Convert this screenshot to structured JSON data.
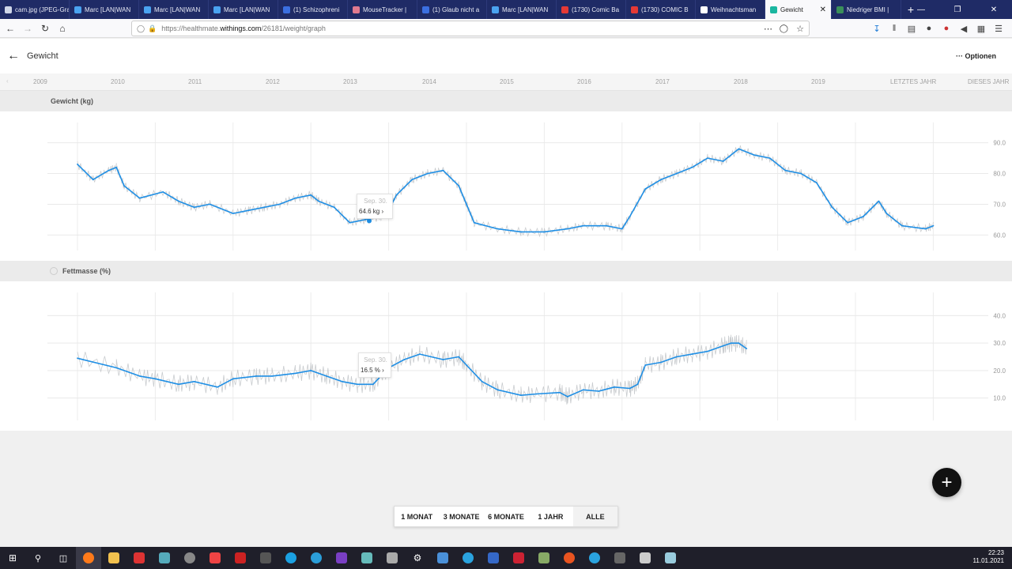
{
  "browser": {
    "tabs": [
      {
        "label": "cam.jpg (JPEG-Grafik",
        "icon": "image-icon",
        "color": "#cfd6e8"
      },
      {
        "label": "Marc [LAN|WAN",
        "icon": "twitter-icon",
        "color": "#4aa3f0"
      },
      {
        "label": "Marc [LAN|WAN",
        "icon": "twitter-icon",
        "color": "#4aa3f0"
      },
      {
        "label": "Marc [LAN|WAN",
        "icon": "twitter-icon",
        "color": "#4aa3f0"
      },
      {
        "label": "(1) Schizophreni",
        "icon": "facebook-icon",
        "color": "#3b6fe0"
      },
      {
        "label": "MouseTracker |",
        "icon": "mousetracker-icon",
        "color": "#e07a8f"
      },
      {
        "label": "(1) Glaub nicht a",
        "icon": "facebook-icon",
        "color": "#3b6fe0"
      },
      {
        "label": "Marc [LAN|WAN",
        "icon": "twitter-icon",
        "color": "#4aa3f0"
      },
      {
        "label": "(1730) Comic Ba",
        "icon": "youtube-icon",
        "color": "#e53935"
      },
      {
        "label": "(1730) COMIC B",
        "icon": "youtube-icon",
        "color": "#e53935"
      },
      {
        "label": "Weihnachtsman",
        "icon": "google-icon",
        "color": "#ffffff"
      },
      {
        "label": "Gewicht",
        "icon": "withings-icon",
        "color": "#1ab6a0",
        "active": true
      },
      {
        "label": "Niedriger BMI |",
        "icon": "page-icon",
        "color": "#3a8f5a"
      }
    ],
    "url_prefix": "https://healthmate.",
    "url_domain": "withings.com",
    "url_path": "/26181/weight/graph"
  },
  "header": {
    "title": "Gewicht",
    "options_label": "Optionen"
  },
  "timeline": {
    "years": [
      "2009",
      "2010",
      "2011",
      "2012",
      "2013",
      "2014",
      "2015",
      "2016",
      "2017",
      "2018",
      "2019"
    ],
    "last_year": "LETZTES JAHR",
    "this_year": "DIESES JAHR"
  },
  "weight_chart": {
    "title": "Gewicht (kg)",
    "tooltip_date": "Sep. 30.",
    "tooltip_value": "64.6 kg"
  },
  "fat_chart": {
    "title": "Fettmasse (%)",
    "tooltip_date": "Sep. 30.",
    "tooltip_value": "16.5 %"
  },
  "range_buttons": [
    "1 MONAT",
    "3 MONATE",
    "6 MONATE",
    "1 JAHR",
    "ALLE"
  ],
  "fab_label": "+",
  "clock": {
    "time": "22:23",
    "date": "11.01.2021"
  },
  "chart_data": [
    {
      "type": "line",
      "title": "Gewicht (kg)",
      "ylim": [
        57,
        93
      ],
      "yticks": [
        60.0,
        70.0,
        80.0,
        90.0
      ],
      "grid": true,
      "x_unit": "year",
      "series": [
        {
          "values": [
            [
              2009.5,
              83
            ],
            [
              2009.7,
              78
            ],
            [
              2009.9,
              81
            ],
            [
              2010.0,
              82
            ],
            [
              2010.1,
              76
            ],
            [
              2010.3,
              72
            ],
            [
              2010.6,
              74
            ],
            [
              2010.8,
              71
            ],
            [
              2011.0,
              69
            ],
            [
              2011.2,
              70
            ],
            [
              2011.5,
              67
            ],
            [
              2011.7,
              68
            ],
            [
              2011.9,
              69
            ],
            [
              2012.1,
              70
            ],
            [
              2012.3,
              72
            ],
            [
              2012.5,
              73
            ],
            [
              2012.6,
              71
            ],
            [
              2012.8,
              69
            ],
            [
              2013.0,
              64
            ],
            [
              2013.2,
              65
            ],
            [
              2013.4,
              66
            ],
            [
              2013.5,
              68
            ],
            [
              2013.6,
              73
            ],
            [
              2013.8,
              78
            ],
            [
              2014.0,
              80
            ],
            [
              2014.2,
              81
            ],
            [
              2014.4,
              76
            ],
            [
              2014.5,
              70
            ],
            [
              2014.6,
              64
            ],
            [
              2014.9,
              62
            ],
            [
              2015.2,
              61
            ],
            [
              2015.5,
              61
            ],
            [
              2015.8,
              62
            ],
            [
              2016.0,
              63
            ],
            [
              2016.3,
              63
            ],
            [
              2016.5,
              62
            ],
            [
              2016.6,
              66
            ],
            [
              2016.8,
              75
            ],
            [
              2017.0,
              78
            ],
            [
              2017.2,
              80
            ],
            [
              2017.4,
              82
            ],
            [
              2017.6,
              85
            ],
            [
              2017.8,
              84
            ],
            [
              2018.0,
              88
            ],
            [
              2018.2,
              86
            ],
            [
              2018.4,
              85
            ],
            [
              2018.6,
              81
            ],
            [
              2018.8,
              80
            ],
            [
              2019.0,
              77
            ],
            [
              2019.2,
              69
            ],
            [
              2019.4,
              64
            ],
            [
              2019.6,
              66
            ],
            [
              2019.8,
              71
            ],
            [
              2019.9,
              67
            ],
            [
              2020.1,
              63
            ],
            [
              2020.4,
              62
            ],
            [
              2020.5,
              63
            ]
          ]
        }
      ]
    },
    {
      "type": "line",
      "title": "Fettmasse (%)",
      "ylim": [
        3,
        43
      ],
      "yticks": [
        10.0,
        20.0,
        30.0,
        40.0
      ],
      "grid": true,
      "x_unit": "year",
      "series": [
        {
          "values": [
            [
              2009.5,
              24.5
            ],
            [
              2010.0,
              21
            ],
            [
              2010.3,
              18
            ],
            [
              2010.5,
              17
            ],
            [
              2010.8,
              15
            ],
            [
              2011.0,
              16
            ],
            [
              2011.3,
              14
            ],
            [
              2011.5,
              17
            ],
            [
              2011.8,
              18
            ],
            [
              2012.0,
              18
            ],
            [
              2012.3,
              19
            ],
            [
              2012.5,
              20
            ],
            [
              2012.7,
              18
            ],
            [
              2012.9,
              16
            ],
            [
              2013.1,
              15
            ],
            [
              2013.3,
              15
            ],
            [
              2013.5,
              21
            ],
            [
              2013.7,
              24
            ],
            [
              2013.9,
              26
            ],
            [
              2014.2,
              24
            ],
            [
              2014.4,
              25
            ],
            [
              2014.5,
              22
            ],
            [
              2014.7,
              16
            ],
            [
              2014.9,
              13
            ],
            [
              2015.2,
              11
            ],
            [
              2015.4,
              11.5
            ],
            [
              2015.7,
              12
            ],
            [
              2015.8,
              10.5
            ],
            [
              2016.0,
              13
            ],
            [
              2016.2,
              12.5
            ],
            [
              2016.4,
              14
            ],
            [
              2016.6,
              13.5
            ],
            [
              2016.7,
              15
            ],
            [
              2016.8,
              22
            ],
            [
              2017.0,
              23
            ],
            [
              2017.2,
              25
            ],
            [
              2017.4,
              26
            ],
            [
              2017.6,
              27
            ],
            [
              2017.8,
              29
            ],
            [
              2017.9,
              30
            ],
            [
              2018.0,
              30
            ],
            [
              2018.1,
              28
            ]
          ]
        }
      ]
    }
  ]
}
